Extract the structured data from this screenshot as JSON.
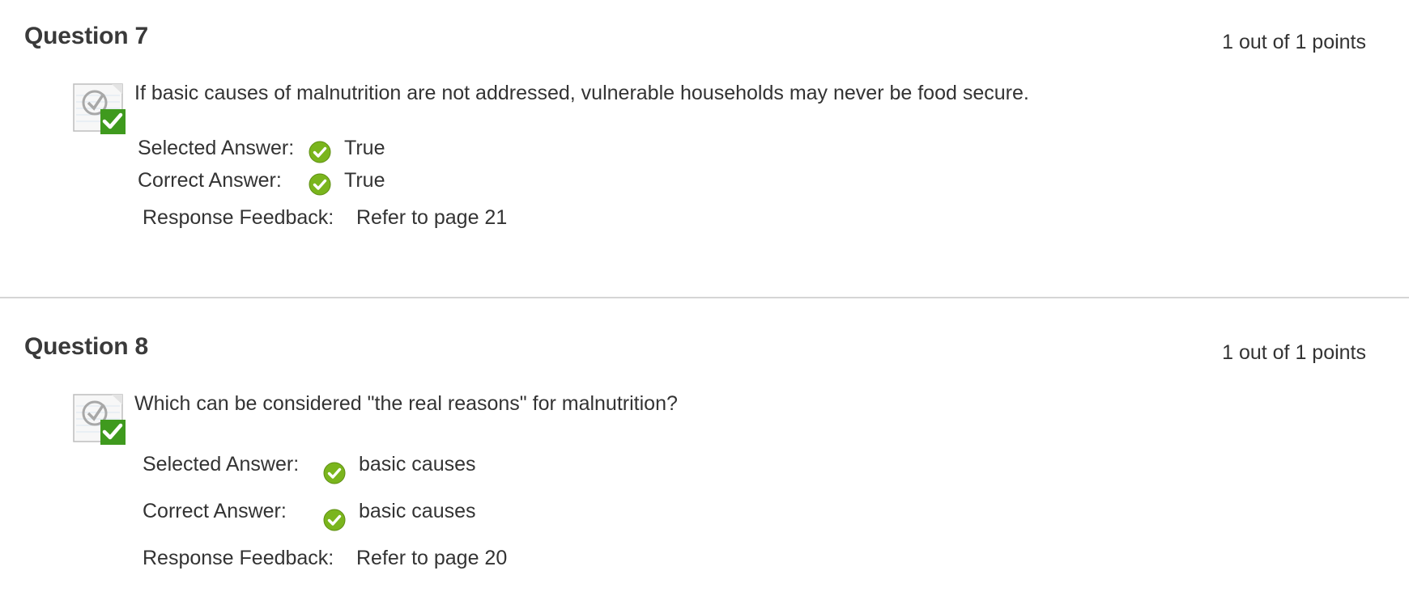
{
  "questions": [
    {
      "title": "Question 7",
      "points": "1 out of 1 points",
      "status_icon": "correct-question-icon",
      "text": "If basic causes of malnutrition are not addressed, vulnerable households may never be food secure.",
      "selected_label": "Selected Answer:",
      "selected_value": "True",
      "correct_label": "Correct Answer:",
      "correct_value": "True",
      "feedback_label": "Response Feedback:",
      "feedback_value": "Refer to page 21"
    },
    {
      "title": "Question 8",
      "points": "1 out of 1 points",
      "status_icon": "correct-question-icon",
      "text": "Which can be considered \"the real reasons\" for malnutrition?",
      "selected_label": "Selected Answer:",
      "selected_value": "basic causes",
      "correct_label": "Correct Answer:",
      "correct_value": "basic causes",
      "feedback_label": "Response Feedback:",
      "feedback_value": "Refer to page 20"
    }
  ],
  "icons": {
    "answer_check": "green-check-circle-icon"
  },
  "colors": {
    "check_green": "#7ab51d",
    "badge_green": "#3f9a1e",
    "text": "#333333",
    "divider": "#d5d5d5"
  }
}
